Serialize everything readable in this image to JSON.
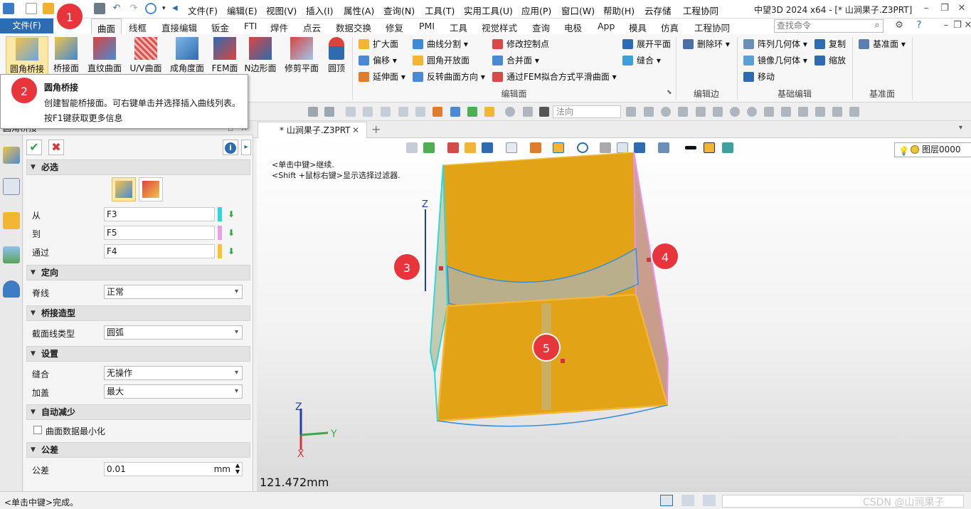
{
  "titlebar": {
    "menus": [
      "文件(F)",
      "编辑(E)",
      "视图(V)",
      "插入(I)",
      "属性(A)",
      "查询(N)",
      "工具(T)",
      "实用工具(U)",
      "应用(P)",
      "窗口(W)",
      "帮助(H)",
      "云存储",
      "工程协同"
    ],
    "app_title": "中望3D 2024 x64 - [* 山涧果子.Z3PRT]"
  },
  "tabs": {
    "file": "文件(F)",
    "items": [
      "曲面",
      "线框",
      "直接编辑",
      "钣金",
      "FTI",
      "焊件",
      "点云",
      "数据交换",
      "修复",
      "PMI",
      "工具",
      "视觉样式",
      "查询",
      "电极",
      "App",
      "模具",
      "仿真",
      "工程协同"
    ],
    "active": "曲面",
    "search_placeholder": "查找命令"
  },
  "ribbon": {
    "big_buttons": [
      "圆角桥接",
      "桥接面",
      "直纹曲面",
      "U/V曲面",
      "成角度面",
      "FEM面",
      "N边形面",
      "修剪平面",
      "圆顶"
    ],
    "edit_col1": [
      "扩大面",
      "偏移",
      "延伸面"
    ],
    "edit_col2": [
      "曲线分割",
      "圆角开放面",
      "反转曲面方向"
    ],
    "edit_col3": [
      "修改控制点",
      "合并面",
      "通过FEM拟合方式平滑曲面"
    ],
    "edit_col4": [
      "展开平面",
      "缝合"
    ],
    "edit_group_label": "编辑面",
    "edge_items": [
      "删除环"
    ],
    "edge_group_label": "编辑边",
    "basic_col1": [
      "阵列几何体",
      "镜像几何体",
      "移动"
    ],
    "basic_col2": [
      "复制",
      "缩放"
    ],
    "basic_group_label": "基础编辑",
    "datum_items": [
      "基准面"
    ],
    "datum_group_label": "基准面"
  },
  "tooltip": {
    "title": "圆角桥接",
    "line1": "创建智能桥接面。可右键单击并选择插入曲线列表。",
    "line2": "按F1键获取更多信息"
  },
  "toolbar2": {
    "filter_value": "法向"
  },
  "panel": {
    "title": "圆角桥接",
    "sections": {
      "required": "必选",
      "orientation": "定向",
      "bridge_shape": "桥接造型",
      "settings": "设置",
      "auto_reduce": "自动减少",
      "tolerance": "公差"
    },
    "from_label": "从",
    "from_value": "F3",
    "to_label": "到",
    "to_value": "F5",
    "through_label": "通过",
    "through_value": "F4",
    "spine_label": "脊线",
    "spine_value": "正常",
    "profile_label": "截面线类型",
    "profile_value": "圆弧",
    "stitch_label": "缝合",
    "stitch_value": "无操作",
    "cap_label": "加盖",
    "cap_value": "最大",
    "minimize_label": "曲面数据最小化",
    "tol_label": "公差",
    "tol_value": "0.01",
    "tol_unit": "mm",
    "from_color": "#2ed8d8",
    "to_color": "#e6a0e6",
    "through_color": "#f2c531"
  },
  "viewport": {
    "doc_tab": "* 山涧果子.Z3PRT",
    "hint1": "<单击中键>继续.",
    "hint2": "<Shift +鼠标右键>显示选择过滤器.",
    "layer": "图层0000",
    "dimension": "121.472mm",
    "axis": {
      "x": "X",
      "y": "Y",
      "z": "Z"
    }
  },
  "badges": [
    "1",
    "2",
    "3",
    "4",
    "5"
  ],
  "status": {
    "text": "<单击中键>完成。",
    "watermark": "CSDN @山涧果子"
  },
  "colors": {
    "accent": "#2b6cb3",
    "surface": "#e2a316",
    "badge": "#e7353b"
  }
}
